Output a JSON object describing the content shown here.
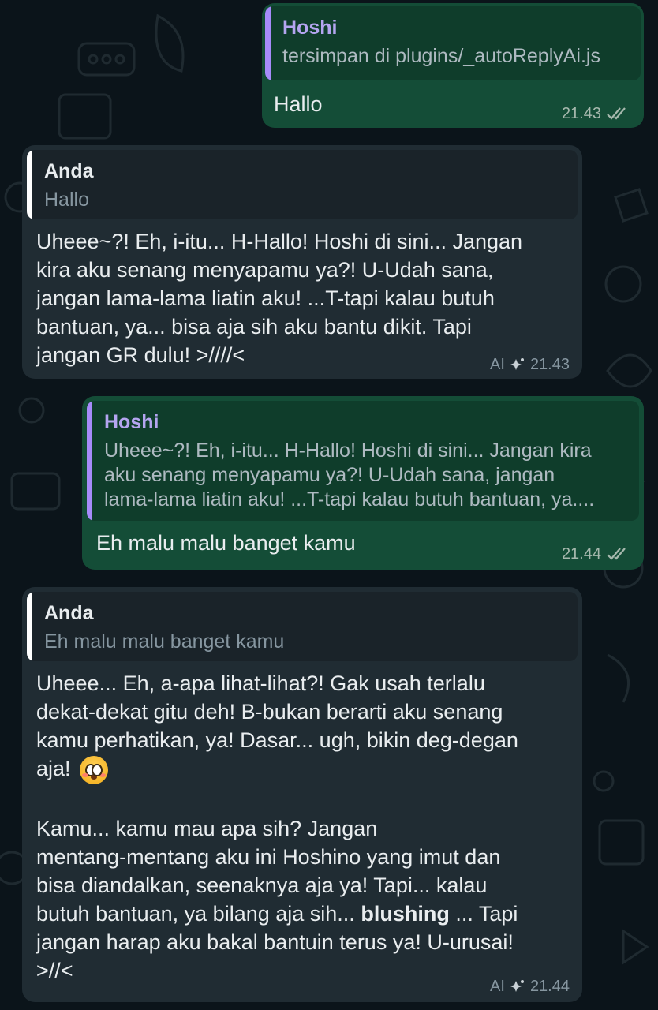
{
  "messages": [
    {
      "direction": "outgoing",
      "quote_name": "Hoshi",
      "quote_lines": [
        "tersimpan di plugins/_autoReplyAi.js"
      ],
      "lines": [
        "Hallo"
      ],
      "time": "21.43",
      "status_icon": "double-check-icon"
    },
    {
      "direction": "incoming",
      "quote_name": "Anda",
      "quote_lines": [
        "Hallo"
      ],
      "lines": [
        "Uheee~?! Eh, i-itu... H-Hallo! Hoshi di sini... Jangan",
        "kira aku senang menyapamu ya?! U-Udah sana,",
        "jangan lama-lama liatin aku! ...T-tapi kalau butuh",
        "bantuan, ya... bisa aja sih aku bantu dikit. Tapi",
        "jangan GR dulu! >////<"
      ],
      "ai_label": "AI",
      "time": "21.43"
    },
    {
      "direction": "outgoing",
      "quote_name": "Hoshi",
      "quote_lines": [
        "Uheee~?! Eh, i-itu... H-Hallo! Hoshi di sini... Jangan kira",
        "aku senang menyapamu ya?! U-Udah sana, jangan",
        "lama-lama liatin aku! ...T-tapi kalau butuh bantuan, ya...."
      ],
      "lines": [
        "Eh malu malu banget kamu"
      ],
      "time": "21.44",
      "status_icon": "double-check-icon"
    },
    {
      "direction": "incoming",
      "quote_name": "Anda",
      "quote_lines": [
        "Eh malu malu banget kamu"
      ],
      "lines": [
        "Uheee... Eh, a-apa lihat-lihat?! Gak usah terlalu",
        "dekat-dekat gitu deh! B-bukan berarti aku senang",
        "kamu perhatikan, ya! Dasar... ugh, bikin deg-degan",
        "aja!",
        "",
        "Kamu... kamu mau apa sih? Jangan",
        "mentang-mentang aku ini Hoshino yang imut dan",
        "bisa diandalkan, seenaknya aja ya! Tapi... kalau",
        "butuh bantuan, ya bilang aja sih...",
        "jangan harap aku bakal bantuin terus ya! U-urusai!",
        ">//<"
      ],
      "bold_word": "blushing",
      "after_bold": " ... Tapi",
      "emoji": "flushed-face-emoji",
      "ai_label": "AI",
      "time": "21.44"
    }
  ],
  "colors": {
    "outgoing_bubble": "#144d37",
    "incoming_bubble": "#202c33",
    "background": "#0b141a",
    "quote_bar_hoshi": "#a78bfa",
    "quote_bar_anda": "#ffffff",
    "tick": "#a6b8ad"
  }
}
